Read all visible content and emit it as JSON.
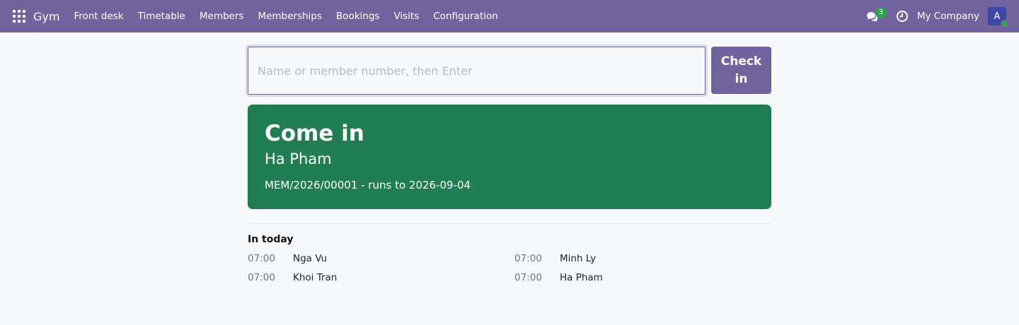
{
  "navbar": {
    "brand": "Gym",
    "menu": [
      "Front desk",
      "Timetable",
      "Members",
      "Memberships",
      "Bookings",
      "Visits",
      "Configuration"
    ],
    "chat_count": "3",
    "company": "My Company",
    "avatar_initial": "A",
    "color": "#71639e"
  },
  "checkin": {
    "placeholder": "Name or member number, then Enter",
    "value": "",
    "button_label": "Check in"
  },
  "result": {
    "title": "Come in",
    "name": "Ha Pham",
    "detail": "MEM/2026/00001 - runs to 2026-09-04",
    "color": "#217e52"
  },
  "today": {
    "title": "In today",
    "entries": [
      {
        "time": "07:00",
        "name": "Nga Vu"
      },
      {
        "time": "07:00",
        "name": "Minh Ly"
      },
      {
        "time": "07:00",
        "name": "Khoi Tran"
      },
      {
        "time": "07:00",
        "name": "Ha Pham"
      }
    ]
  }
}
